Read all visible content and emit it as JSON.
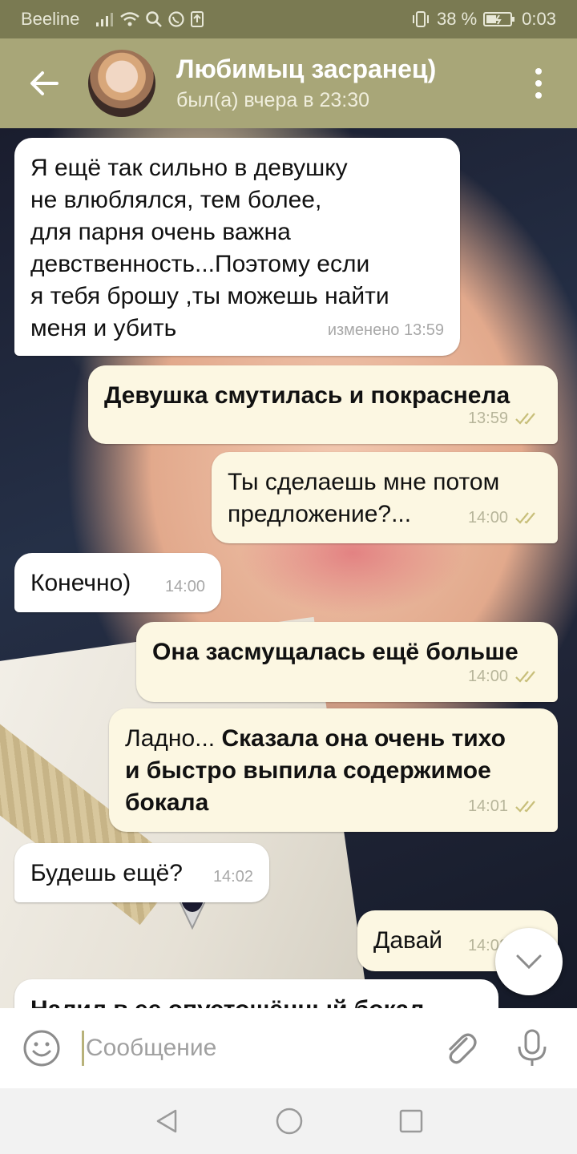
{
  "status_bar": {
    "carrier": "Beeline",
    "battery": "38 %",
    "time": "0:03"
  },
  "header": {
    "contact_name": "Любимыц засранец)",
    "last_seen": "был(а) вчера в 23:30",
    "icons": [
      "back-arrow-icon",
      "more-vert-icon"
    ]
  },
  "messages": [
    {
      "direction": "in",
      "lines": [
        "Я ещё так сильно в девушку",
        "не влюблялся, тем более,",
        "для парня очень важна",
        "девственность...Поэтому если",
        "я тебя брошу ,ты можешь найти",
        "меня и убить"
      ],
      "meta": "изменено 13:59"
    },
    {
      "direction": "out",
      "text": "Девушка смутилась и покраснела",
      "time": "13:59",
      "status": "read"
    },
    {
      "direction": "out",
      "lines": [
        "Ты сделаешь мне потом",
        "предложение?..."
      ],
      "time": "14:00",
      "status": "read"
    },
    {
      "direction": "in",
      "text": "Конечно)",
      "time": "14:00"
    },
    {
      "direction": "out",
      "text": "Она засмущалась ещё больше",
      "time": "14:00",
      "status": "read"
    },
    {
      "direction": "out",
      "plain": "Ладно...",
      "bold_1": "Сказала она очень тихо",
      "bold_2": "и быстро выпила содержимое",
      "bold_3": "бокала",
      "time": "14:01",
      "status": "read"
    },
    {
      "direction": "in",
      "text": "Будешь ещё?",
      "time": "14:02"
    },
    {
      "direction": "out",
      "text": "Давай",
      "time": "14:02",
      "status": "read"
    },
    {
      "direction": "in",
      "text": "Налил в ее опустошённый бокал"
    }
  ],
  "input": {
    "placeholder": "Сообщение"
  },
  "colors": {
    "header": "#a8a678",
    "status_bar": "#7a7a52",
    "incoming_bubble": "#ffffff",
    "outgoing_bubble": "#fcf7e2",
    "read_checks": "#c8bf7a"
  }
}
